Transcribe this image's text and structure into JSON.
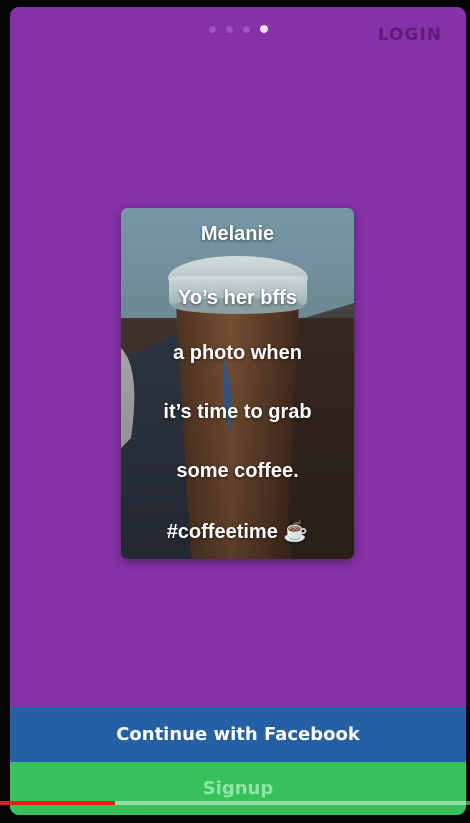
{
  "header": {
    "pager": {
      "count": 4,
      "active_index": 3
    },
    "login_label": "LOGIN"
  },
  "card": {
    "lines": [
      "Melanie",
      "Yo’s her bffs",
      "a photo when",
      "it’s time to grab",
      "some coffee.",
      "#coffeetime ☕"
    ]
  },
  "buttons": {
    "facebook_label": "Continue with Facebook",
    "signup_label": "Signup"
  },
  "video_progress": {
    "played_fraction": 0.245
  },
  "colors": {
    "background": "#8531a8",
    "facebook": "#2460a3",
    "signup": "#36c15b",
    "progress": "#e1201c"
  }
}
